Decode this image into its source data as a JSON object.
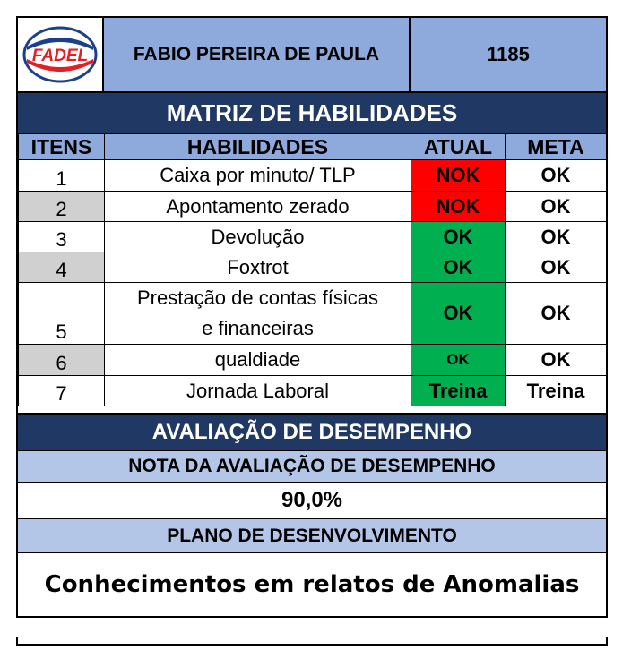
{
  "header": {
    "logo_text": "FADEL",
    "employee_name": "FABIO PEREIRA DE PAULA",
    "employee_id": "1185",
    "colors": {
      "brand_red": "#e31e24",
      "brand_blue": "#1b3f8f"
    }
  },
  "matrix": {
    "title": "MATRIZ DE HABILIDADES",
    "columns": {
      "items": "ITENS",
      "skills": "HABILIDADES",
      "current": "ATUAL",
      "target": "META"
    },
    "rows": [
      {
        "item": "1",
        "skill": "Caixa por minuto/ TLP",
        "current": "NOK",
        "target": "OK",
        "current_status": "red"
      },
      {
        "item": "2",
        "skill": "Apontamento zerado",
        "current": "NOK",
        "target": "OK",
        "current_status": "red"
      },
      {
        "item": "3",
        "skill": "Devolução",
        "current": "OK",
        "target": "OK",
        "current_status": "green"
      },
      {
        "item": "4",
        "skill": "Foxtrot",
        "current": "OK",
        "target": "OK",
        "current_status": "green"
      },
      {
        "item": "5",
        "skill_line1": "Prestação de contas físicas",
        "skill_line2": "e financeiras",
        "current": "OK",
        "target": "OK",
        "current_status": "green"
      },
      {
        "item": "6",
        "skill": "qualdiade",
        "current": "OK",
        "target": "OK",
        "current_status": "green"
      },
      {
        "item": "7",
        "skill": "Jornada Laboral",
        "current": "Treina",
        "target": "Treina",
        "current_status": "green"
      }
    ],
    "colors": {
      "red": "#ff0000",
      "green": "#00b050",
      "header_blue": "#8ea9db",
      "band_navy": "#1f3864",
      "gray": "#d0d0d0"
    }
  },
  "evaluation": {
    "title": "AVALIAÇÃO DE DESEMPENHO",
    "score_label": "NOTA DA AVALIAÇÃO DE DESEMPENHO",
    "score_value": "90,0%",
    "plan_label": "PLANO DE DESENVOLVIMENTO",
    "plan_text": "Conhecimentos em relatos de Anomalias"
  }
}
